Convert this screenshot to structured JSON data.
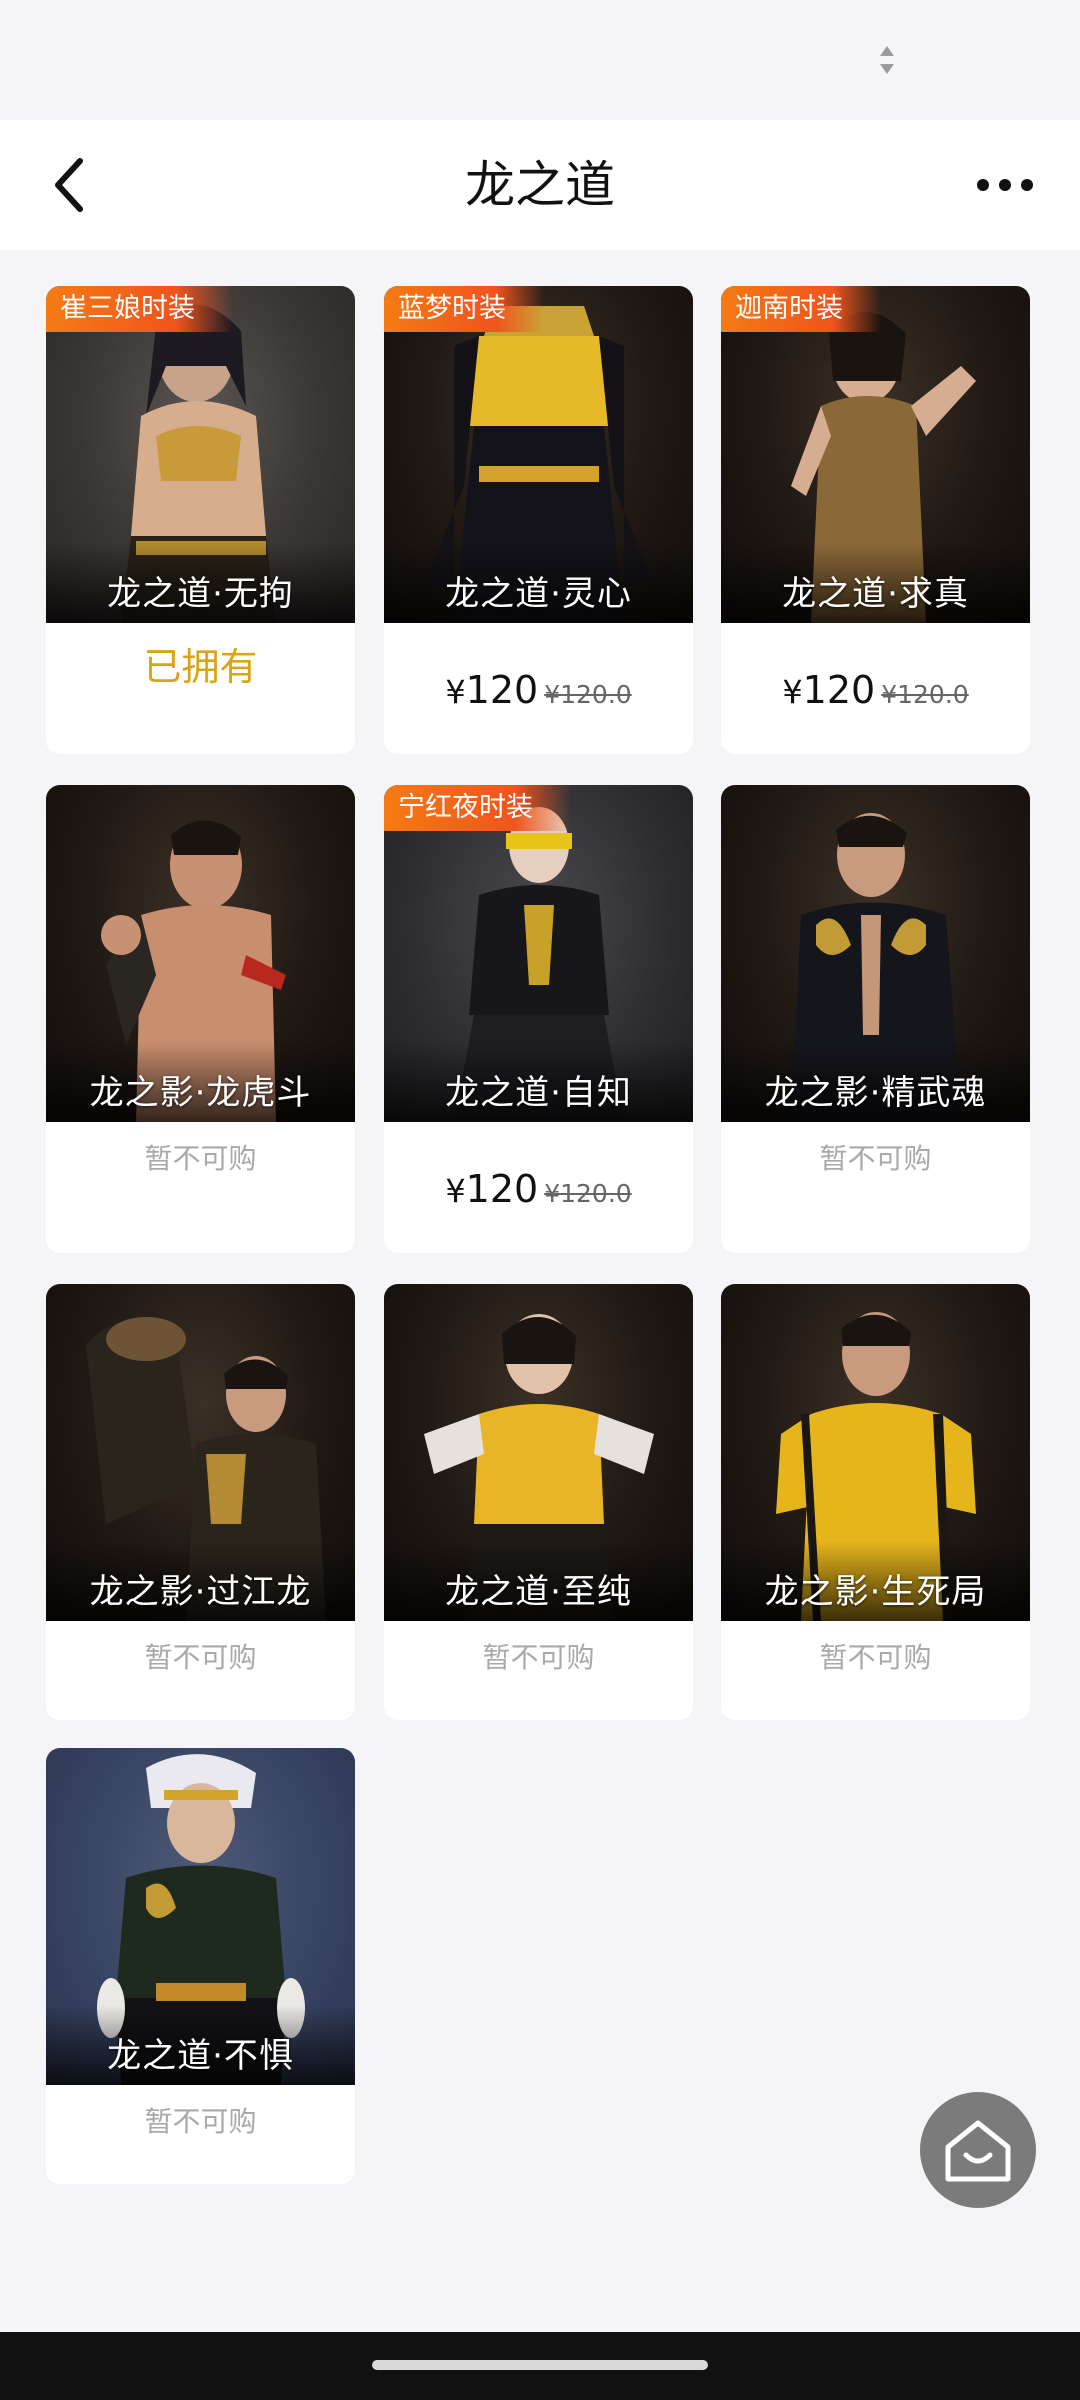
{
  "header": {
    "title": "龙之道"
  },
  "icons": {
    "back": "back-arrow-icon",
    "more": "more-dots-icon",
    "home": "home-icon",
    "status": "sort-arrows-icon"
  },
  "items": [
    {
      "tag": "崔三娘时装",
      "name": "龙之道·无拘",
      "status": "owned",
      "status_text": "已拥有"
    },
    {
      "tag": "蓝梦时装",
      "name": "龙之道·灵心",
      "status": "price",
      "price_symbol": "¥",
      "price": "120",
      "original_price": "¥120.0"
    },
    {
      "tag": "迦南时装",
      "name": "龙之道·求真",
      "status": "price",
      "price_symbol": "¥",
      "price": "120",
      "original_price": "¥120.0"
    },
    {
      "tag": "",
      "name": "龙之影·龙虎斗",
      "status": "unavailable",
      "status_text": "暂不可购"
    },
    {
      "tag": "宁红夜时装",
      "name": "龙之道·自知",
      "status": "price",
      "price_symbol": "¥",
      "price": "120",
      "original_price": "¥120.0"
    },
    {
      "tag": "",
      "name": "龙之影·精武魂",
      "status": "unavailable",
      "status_text": "暂不可购"
    },
    {
      "tag": "",
      "name": "龙之影·过江龙",
      "status": "unavailable",
      "status_text": "暂不可购"
    },
    {
      "tag": "",
      "name": "龙之道·至纯",
      "status": "unavailable",
      "status_text": "暂不可购"
    },
    {
      "tag": "",
      "name": "龙之影·生死局",
      "status": "unavailable",
      "status_text": "暂不可购"
    },
    {
      "tag": "",
      "name": "龙之道·不惧",
      "status": "unavailable",
      "status_text": "暂不可购"
    }
  ],
  "colors": {
    "owned": "#d9a418",
    "unavailable": "#a9a9a9",
    "tag_gradient_start": "#f47b14",
    "tag_gradient_end": "#f0541d"
  }
}
